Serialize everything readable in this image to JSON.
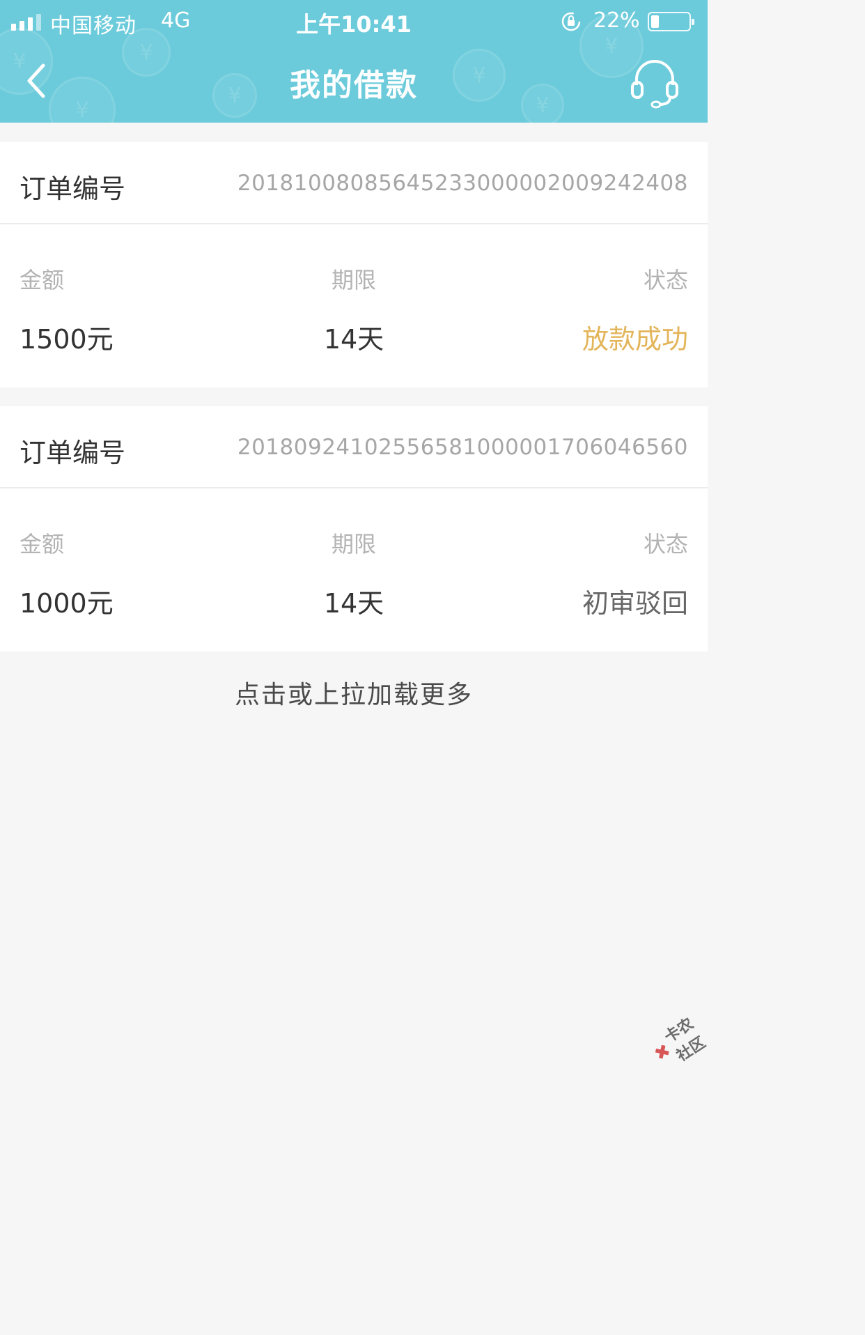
{
  "status_bar": {
    "carrier": "中国移动",
    "network": "4G",
    "time": "上午10:41",
    "battery_percent": "22%",
    "battery_level": 0.22,
    "icons": [
      "signal-icon",
      "orientation-lock-icon",
      "battery-icon"
    ]
  },
  "nav": {
    "title": "我的借款",
    "back_icon": "chevron-left-icon",
    "support_icon": "headset-icon"
  },
  "orders": [
    {
      "order_label": "订单编号",
      "order_number": "20181008085645233000002009242408",
      "amount_label": "金额",
      "amount": "1500元",
      "term_label": "期限",
      "term": "14天",
      "status_label": "状态",
      "status": "放款成功",
      "status_color": "#e3b55a"
    },
    {
      "order_label": "订单编号",
      "order_number": "20180924102556581000001706046560",
      "amount_label": "金额",
      "amount": "1000元",
      "term_label": "期限",
      "term": "14天",
      "status_label": "状态",
      "status": "初审驳回",
      "status_color": "#666666"
    }
  ],
  "load_more": "点击或上拉加载更多",
  "watermark": "卡农社区",
  "colors": {
    "header_bg": "#6ccbdb",
    "page_bg": "#f6f6f6",
    "accent_success": "#e3b55a"
  }
}
